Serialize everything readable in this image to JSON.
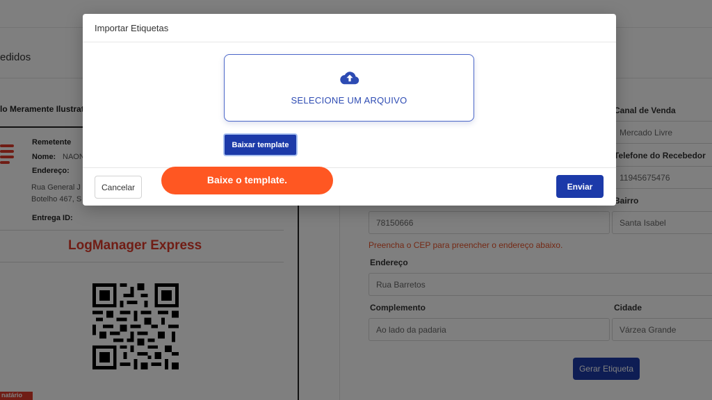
{
  "background": {
    "page_title": "edidos",
    "label_card": {
      "title": "lo Meramente Ilustrati",
      "remetente_heading": "Remetente",
      "nome_label": "Nome:",
      "nome_value": "NAON",
      "endereco_label": "Endereço:",
      "address_line1": "Rua General J",
      "address_line2": "Botelho 467, S",
      "entrega_label": "Entrega ID:",
      "brand": "LogManager Express",
      "destinatario_badge": "natário"
    },
    "form": {
      "canal_label": "Canal de Venda",
      "canal_value": "Mercado Livre",
      "telefone_label": "Telefone do Recebedor",
      "telefone_value": "11945675476",
      "cep_value": "78150666",
      "bairro_label": "Bairro",
      "bairro_value": "Santa Isabel",
      "cep_hint": "Preencha o CEP para preencher o endereço abaixo.",
      "endereco_label": "Endereço",
      "endereco_value": "Rua Barretos",
      "complemento_label": "Complemento",
      "complemento_value": "Ao lado da padaria",
      "cidade_label": "Cidade",
      "cidade_value": "Várzea Grande",
      "generate_button": "Gerar Etiqueta"
    }
  },
  "modal": {
    "title": "Importar Etiquetas",
    "upload_icon": "cloud-upload-icon",
    "dropzone_label": "SELECIONE UM ARQUIVO",
    "template_button": "Baixar template",
    "cancel_button": "Cancelar",
    "send_button": "Enviar"
  },
  "tooltip": {
    "text": "Baixe o template."
  },
  "colors": {
    "primary": "#1c3aa9",
    "accent_orange": "#ff5722",
    "brand_red": "#e03a2a",
    "hint_orange": "#e8532a"
  }
}
